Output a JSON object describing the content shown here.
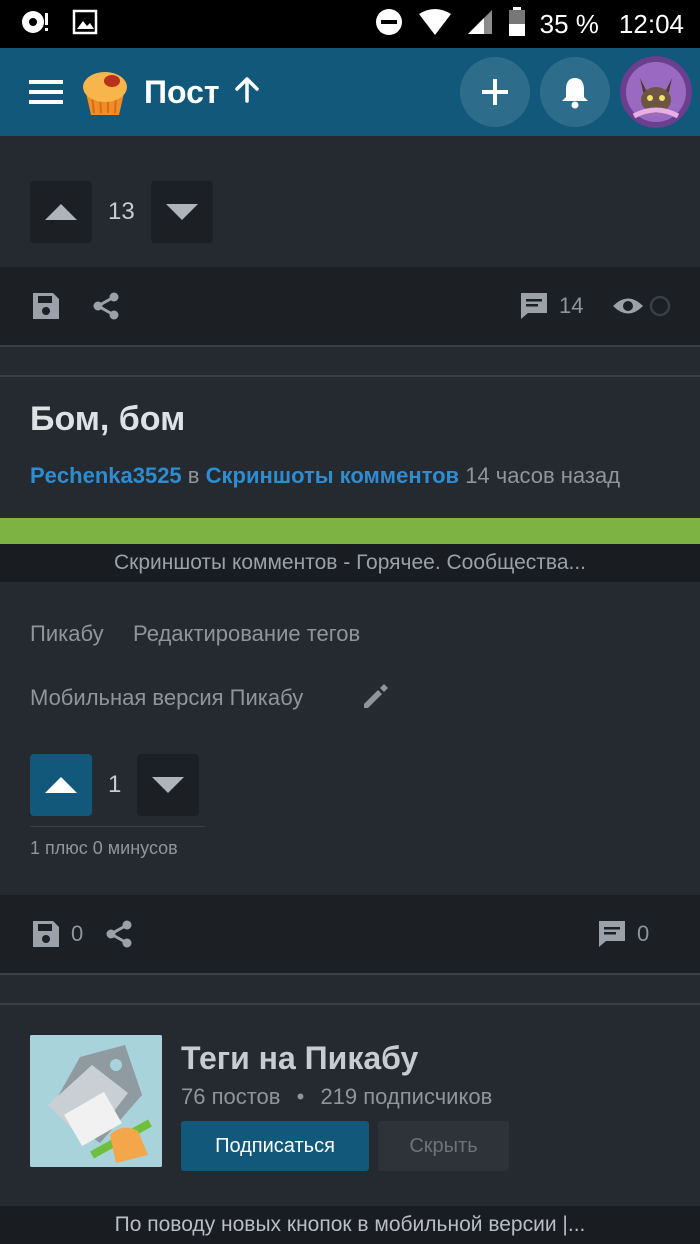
{
  "statusbar": {
    "battery": "35 %",
    "time": "12:04"
  },
  "appbar": {
    "title": "Пост"
  },
  "post_prev": {
    "rating": "13",
    "comments": "14"
  },
  "post": {
    "title": "Бом, бом",
    "author": "Pechenka3525",
    "in": "в",
    "community": "Скриншоты комментов",
    "time": "14 часов назад",
    "embed_title": "Скриншоты комментов - Горячее. Сообщества...",
    "link1": "Пикабу",
    "link2": "Редактирование тегов",
    "link3": "Мобильная версия Пикабу",
    "rating": "1",
    "pluses": "1 плюс 0 минусов",
    "saves": "0",
    "comments": "0"
  },
  "community_card": {
    "title": "Теги на Пикабу",
    "posts": "76 постов",
    "dot": "•",
    "subscribers": "219 подписчиков",
    "subscribe": "Подписаться",
    "hide": "Скрыть"
  },
  "bottom_bar": {
    "text": "По поводу новых кнопок в мобильной версии |..."
  },
  "colors": {
    "appbar": "#11587a",
    "background": "#252a30",
    "link": "#2f8ccf",
    "accent_green": "#7cb342"
  }
}
